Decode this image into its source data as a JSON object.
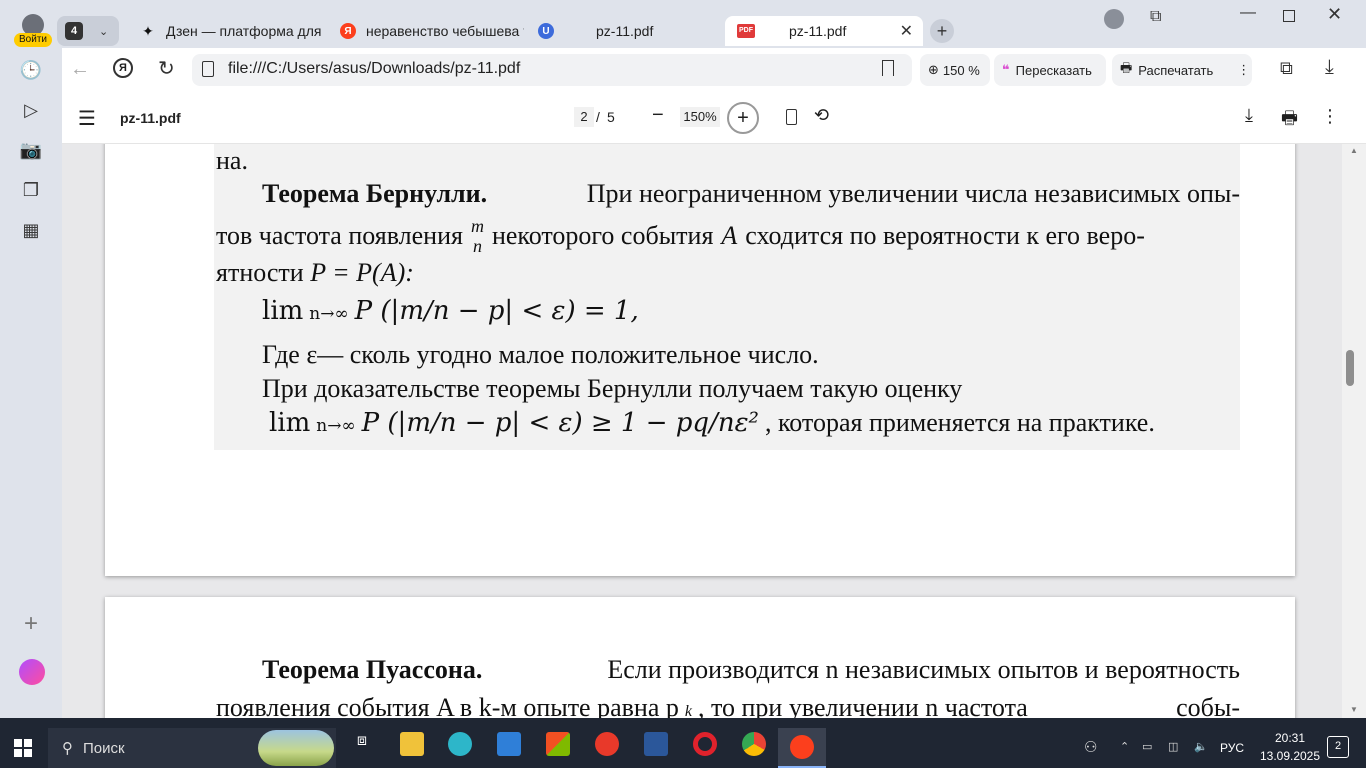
{
  "sidebar": {
    "profile_label": "Войти",
    "items": [
      {
        "icon": "clock-icon",
        "glyph": "🕒"
      },
      {
        "icon": "play-icon",
        "glyph": "▷"
      },
      {
        "icon": "camera-icon",
        "glyph": "📷"
      },
      {
        "icon": "notes-icon",
        "glyph": "❐"
      },
      {
        "icon": "apps-icon",
        "glyph": "▦"
      }
    ],
    "add_glyph": "+"
  },
  "tabs": {
    "group_count": "4",
    "items": [
      {
        "title": "Дзен — платформа для пр",
        "icon": "zen-icon",
        "color": "#111111"
      },
      {
        "title": "неравенство чебышева те",
        "icon": "yandex-icon",
        "color": "#fc3f1d"
      },
      {
        "title": "pz-11.pdf",
        "icon": "u-icon",
        "color": "#3d6bdb"
      },
      {
        "title": "pz-11.pdf",
        "icon": "pdf-icon",
        "color": "#e03a3a",
        "active": true
      }
    ],
    "new_tab": "+"
  },
  "address": {
    "url": "file:///C:/Users/asus/Downloads/pz-11.pdf",
    "zoom": "150 %",
    "retell": "Пересказать",
    "print": "Распечатать"
  },
  "pdf": {
    "filename": "pz-11.pdf",
    "page_current": "2",
    "page_sep": "/",
    "page_total": "5",
    "zoom": "150%"
  },
  "doc": {
    "line0": "на.",
    "bern_title": "Теорема Бернулли.",
    "bern_l1": "При неограниченном увеличении числа независимых опы-",
    "bern_l2a": "тов частота появления",
    "frac_m": "m",
    "frac_n": "n",
    "bern_l2b": "некоторого события",
    "bern_A": "A",
    "bern_l2c": "сходится по вероятности к его веро-",
    "bern_l3": "ятности",
    "bern_l3f": "P = P(A):",
    "formula1": "lim",
    "formula1_sub": "n→∞",
    "formula1_body": "P (|m/n − p| < ε) = 1,",
    "where": "Где ε— сколь угодно малое положительное число.",
    "proof": "При доказательстве теоремы Бернулли получаем такую оценку",
    "formula2_body": "P (|m/n − p| < ε) ≥ 1 − pq/nε²",
    "formula2_tail": ", которая применяется на практике.",
    "pois_title": "Теорема Пуассона.",
    "pois_l1": "Если производится n независимых опытов и вероятность",
    "pois_l2": "появления события A в k-м опыте равна p",
    "pois_l2_sub": "k",
    "pois_l2b": ", то при увеличении n частота",
    "pois_l2c": "собы-"
  },
  "taskbar": {
    "search": "Поиск",
    "lang": "РУС",
    "time": "20:31",
    "date": "13.09.2025",
    "notif": "2"
  }
}
